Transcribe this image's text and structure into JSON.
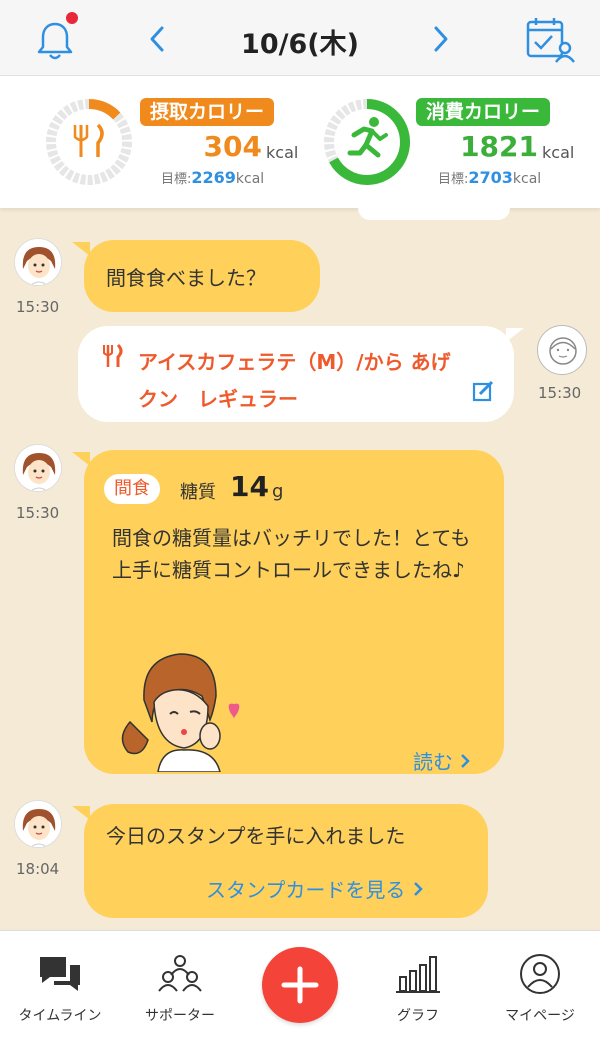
{
  "header": {
    "date": "10/6(木)"
  },
  "summary": {
    "intake": {
      "label": "摂取カロリー",
      "value": "304",
      "unit": "kcal",
      "goal_label": "目標:",
      "goal_value": "2269",
      "goal_unit": "kcal",
      "progress": 0.13,
      "color": "#f08a1c"
    },
    "burn": {
      "label": "消費カロリー",
      "value": "1821",
      "unit": "kcal",
      "goal_label": "目標:",
      "goal_value": "2703",
      "goal_unit": "kcal",
      "progress": 0.67,
      "color": "#39b83a"
    }
  },
  "chat": {
    "msg1": {
      "time": "15:30",
      "text": "間食食べました？"
    },
    "food": {
      "time": "15:30",
      "text": "アイスカフェラテ（M）/から あげクン　レギュラー"
    },
    "advice": {
      "time": "15:30",
      "tag": "間食",
      "sugar_label": "糖質",
      "sugar_value": "14",
      "sugar_unit": "g",
      "text": "間食の糖質量はバッチリでした！とても上手に糖質コントロールできましたね♪",
      "read_more": "読む"
    },
    "stamp": {
      "time": "18:04",
      "text": "今日のスタンプを手に入れました",
      "link": "スタンプカードを見る"
    }
  },
  "tabs": [
    {
      "label": "タイムライン",
      "icon": "chat-bubbles-icon"
    },
    {
      "label": "サポーター",
      "icon": "people-icon"
    },
    {
      "label": "",
      "icon": "plus-icon"
    },
    {
      "label": "グラフ",
      "icon": "bar-chart-icon"
    },
    {
      "label": "マイページ",
      "icon": "person-circle-icon"
    }
  ],
  "colors": {
    "accent_orange": "#f08a1c",
    "accent_green": "#39b83a",
    "bubble_yellow": "#ffd15a",
    "link_blue": "#2f8fe0",
    "fab_red": "#f4443a",
    "background": "#f4ead6"
  }
}
